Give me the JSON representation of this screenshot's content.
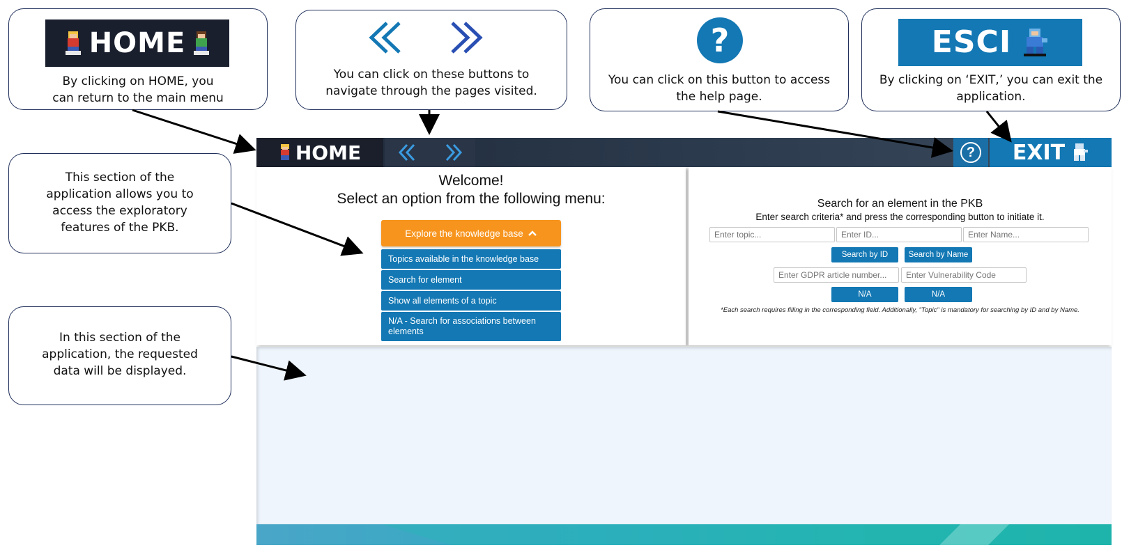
{
  "callouts": {
    "home": {
      "logo_text": "HOME",
      "text_line1": "By clicking on HOME, you",
      "text_line2": "can return to the main menu"
    },
    "nav": {
      "text_line1": "You can click on these buttons to",
      "text_line2": "navigate through the pages visited."
    },
    "help": {
      "text_line1": "You can click on this button to access",
      "text_line2": "the help page."
    },
    "exit": {
      "logo_text": "ESCI",
      "text_line1": "By clicking on ‘EXIT,’ you can exit the",
      "text_line2": "application."
    },
    "explore": {
      "l1": "This section of the",
      "l2": "application allows you to",
      "l3": "access the exploratory",
      "l4": "features of the PKB."
    },
    "data": {
      "l1": "In this section of the",
      "l2": "application, the requested",
      "l3": "data will be displayed."
    }
  },
  "topbar": {
    "home_label": "HOME",
    "exit_label": "EXIT",
    "help_glyph": "?"
  },
  "left_panel": {
    "welcome_line1": "Welcome!",
    "welcome_line2": "Select an option from the following menu:",
    "explore_button": "Explore the knowledge base",
    "menu_items": [
      "Topics available in the knowledge base",
      "Search for element",
      "Show all elements of a topic",
      "N/A - Search for associations between elements"
    ]
  },
  "right_panel": {
    "title": "Search for an element in the PKB",
    "subtitle": "Enter search criteria* and press the corresponding button to initiate it.",
    "topic_placeholder": "Enter topic...",
    "id_placeholder": "Enter ID...",
    "name_placeholder": "Enter Name...",
    "search_id_button": "Search by ID",
    "search_name_button": "Search by Name",
    "gdpr_placeholder": "Enter GDPR article number...",
    "vuln_placeholder": "Enter Vulnerability Code",
    "na_button_1": "N/A",
    "na_button_2": "N/A",
    "footnote": "*Each search requires filling in the corresponding field. Additionally, \"Topic\" is mandatory for searching by ID and by Name."
  },
  "colors": {
    "accent_blue": "#1378b4",
    "orange": "#f7941d",
    "dark_bar": "#1f2a3a",
    "teal": "#1fb5aa"
  },
  "icons": [
    "home-icon",
    "back-icon",
    "forward-icon",
    "help-icon",
    "exit-icon",
    "chevron-up-icon"
  ]
}
